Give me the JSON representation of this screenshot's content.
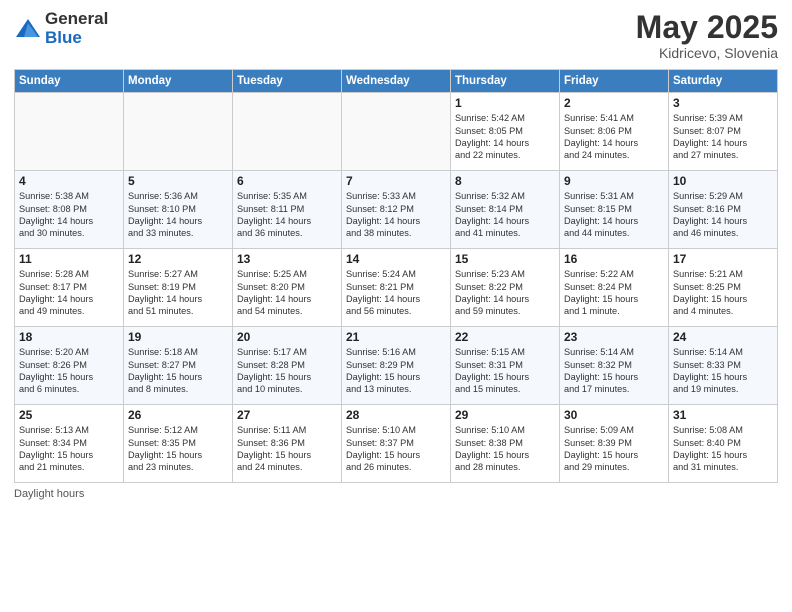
{
  "logo": {
    "general": "General",
    "blue": "Blue"
  },
  "title": {
    "month": "May 2025",
    "location": "Kidricevo, Slovenia"
  },
  "days_of_week": [
    "Sunday",
    "Monday",
    "Tuesday",
    "Wednesday",
    "Thursday",
    "Friday",
    "Saturday"
  ],
  "weeks": [
    [
      {
        "day": "",
        "detail": ""
      },
      {
        "day": "",
        "detail": ""
      },
      {
        "day": "",
        "detail": ""
      },
      {
        "day": "",
        "detail": ""
      },
      {
        "day": "1",
        "detail": "Sunrise: 5:42 AM\nSunset: 8:05 PM\nDaylight: 14 hours\nand 22 minutes."
      },
      {
        "day": "2",
        "detail": "Sunrise: 5:41 AM\nSunset: 8:06 PM\nDaylight: 14 hours\nand 24 minutes."
      },
      {
        "day": "3",
        "detail": "Sunrise: 5:39 AM\nSunset: 8:07 PM\nDaylight: 14 hours\nand 27 minutes."
      }
    ],
    [
      {
        "day": "4",
        "detail": "Sunrise: 5:38 AM\nSunset: 8:08 PM\nDaylight: 14 hours\nand 30 minutes."
      },
      {
        "day": "5",
        "detail": "Sunrise: 5:36 AM\nSunset: 8:10 PM\nDaylight: 14 hours\nand 33 minutes."
      },
      {
        "day": "6",
        "detail": "Sunrise: 5:35 AM\nSunset: 8:11 PM\nDaylight: 14 hours\nand 36 minutes."
      },
      {
        "day": "7",
        "detail": "Sunrise: 5:33 AM\nSunset: 8:12 PM\nDaylight: 14 hours\nand 38 minutes."
      },
      {
        "day": "8",
        "detail": "Sunrise: 5:32 AM\nSunset: 8:14 PM\nDaylight: 14 hours\nand 41 minutes."
      },
      {
        "day": "9",
        "detail": "Sunrise: 5:31 AM\nSunset: 8:15 PM\nDaylight: 14 hours\nand 44 minutes."
      },
      {
        "day": "10",
        "detail": "Sunrise: 5:29 AM\nSunset: 8:16 PM\nDaylight: 14 hours\nand 46 minutes."
      }
    ],
    [
      {
        "day": "11",
        "detail": "Sunrise: 5:28 AM\nSunset: 8:17 PM\nDaylight: 14 hours\nand 49 minutes."
      },
      {
        "day": "12",
        "detail": "Sunrise: 5:27 AM\nSunset: 8:19 PM\nDaylight: 14 hours\nand 51 minutes."
      },
      {
        "day": "13",
        "detail": "Sunrise: 5:25 AM\nSunset: 8:20 PM\nDaylight: 14 hours\nand 54 minutes."
      },
      {
        "day": "14",
        "detail": "Sunrise: 5:24 AM\nSunset: 8:21 PM\nDaylight: 14 hours\nand 56 minutes."
      },
      {
        "day": "15",
        "detail": "Sunrise: 5:23 AM\nSunset: 8:22 PM\nDaylight: 14 hours\nand 59 minutes."
      },
      {
        "day": "16",
        "detail": "Sunrise: 5:22 AM\nSunset: 8:24 PM\nDaylight: 15 hours\nand 1 minute."
      },
      {
        "day": "17",
        "detail": "Sunrise: 5:21 AM\nSunset: 8:25 PM\nDaylight: 15 hours\nand 4 minutes."
      }
    ],
    [
      {
        "day": "18",
        "detail": "Sunrise: 5:20 AM\nSunset: 8:26 PM\nDaylight: 15 hours\nand 6 minutes."
      },
      {
        "day": "19",
        "detail": "Sunrise: 5:18 AM\nSunset: 8:27 PM\nDaylight: 15 hours\nand 8 minutes."
      },
      {
        "day": "20",
        "detail": "Sunrise: 5:17 AM\nSunset: 8:28 PM\nDaylight: 15 hours\nand 10 minutes."
      },
      {
        "day": "21",
        "detail": "Sunrise: 5:16 AM\nSunset: 8:29 PM\nDaylight: 15 hours\nand 13 minutes."
      },
      {
        "day": "22",
        "detail": "Sunrise: 5:15 AM\nSunset: 8:31 PM\nDaylight: 15 hours\nand 15 minutes."
      },
      {
        "day": "23",
        "detail": "Sunrise: 5:14 AM\nSunset: 8:32 PM\nDaylight: 15 hours\nand 17 minutes."
      },
      {
        "day": "24",
        "detail": "Sunrise: 5:14 AM\nSunset: 8:33 PM\nDaylight: 15 hours\nand 19 minutes."
      }
    ],
    [
      {
        "day": "25",
        "detail": "Sunrise: 5:13 AM\nSunset: 8:34 PM\nDaylight: 15 hours\nand 21 minutes."
      },
      {
        "day": "26",
        "detail": "Sunrise: 5:12 AM\nSunset: 8:35 PM\nDaylight: 15 hours\nand 23 minutes."
      },
      {
        "day": "27",
        "detail": "Sunrise: 5:11 AM\nSunset: 8:36 PM\nDaylight: 15 hours\nand 24 minutes."
      },
      {
        "day": "28",
        "detail": "Sunrise: 5:10 AM\nSunset: 8:37 PM\nDaylight: 15 hours\nand 26 minutes."
      },
      {
        "day": "29",
        "detail": "Sunrise: 5:10 AM\nSunset: 8:38 PM\nDaylight: 15 hours\nand 28 minutes."
      },
      {
        "day": "30",
        "detail": "Sunrise: 5:09 AM\nSunset: 8:39 PM\nDaylight: 15 hours\nand 29 minutes."
      },
      {
        "day": "31",
        "detail": "Sunrise: 5:08 AM\nSunset: 8:40 PM\nDaylight: 15 hours\nand 31 minutes."
      }
    ]
  ],
  "footer": {
    "text": "Daylight hours"
  }
}
